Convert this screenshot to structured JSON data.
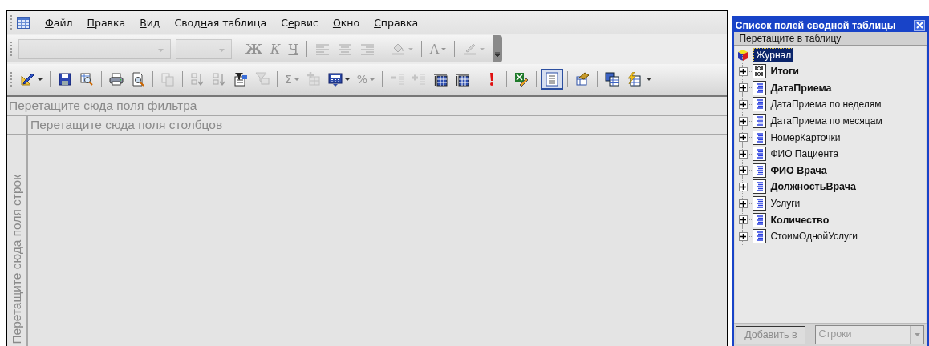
{
  "menu": [
    {
      "key": "Ф",
      "post": "айл"
    },
    {
      "key": "П",
      "post": "равка"
    },
    {
      "key": "В",
      "post": "ид"
    },
    {
      "pre": "Свод",
      "key": "н",
      "post": "ая таблица"
    },
    {
      "pre": "С",
      "key": "е",
      "post": "рвис"
    },
    {
      "key": "О",
      "post": "кно"
    },
    {
      "key": "С",
      "post": "правка"
    }
  ],
  "format_toolbar": [
    {
      "kind": "font-combo",
      "disabled": true
    },
    {
      "kind": "size-combo",
      "disabled": true
    },
    {
      "kind": "sep"
    },
    {
      "kind": "bold",
      "label": "Ж",
      "disabled": true
    },
    {
      "kind": "italic",
      "label": "К",
      "disabled": true
    },
    {
      "kind": "underline",
      "label": "Ч",
      "disabled": true
    },
    {
      "kind": "sep"
    },
    {
      "kind": "align-left",
      "disabled": true
    },
    {
      "kind": "align-center",
      "disabled": true
    },
    {
      "kind": "align-right",
      "disabled": true
    },
    {
      "kind": "sep"
    },
    {
      "kind": "fill",
      "dropdown": true,
      "disabled": true
    },
    {
      "kind": "sep"
    },
    {
      "kind": "font-color",
      "label": "A",
      "dropdown": true,
      "disabled": true
    },
    {
      "kind": "sep"
    },
    {
      "kind": "line-color",
      "dropdown": true,
      "disabled": true
    },
    {
      "kind": "overflow"
    }
  ],
  "pivot_toolbar": [
    {
      "kind": "format",
      "dropdown": true,
      "disabled": false,
      "selected": false
    },
    {
      "kind": "sep"
    },
    {
      "kind": "save",
      "disabled": false,
      "selected": false
    },
    {
      "kind": "zoom-table",
      "disabled": false,
      "selected": false
    },
    {
      "kind": "sep"
    },
    {
      "kind": "print",
      "disabled": false,
      "selected": false
    },
    {
      "kind": "preview",
      "disabled": false,
      "selected": false
    },
    {
      "kind": "sep"
    },
    {
      "kind": "copy",
      "disabled": true,
      "selected": false
    },
    {
      "kind": "sep"
    },
    {
      "kind": "sort-asc",
      "disabled": true,
      "selected": false
    },
    {
      "kind": "sort-desc",
      "disabled": true,
      "selected": false
    },
    {
      "kind": "filter",
      "disabled": false,
      "selected": false
    },
    {
      "kind": "top",
      "disabled": true,
      "selected": false
    },
    {
      "kind": "sep"
    },
    {
      "kind": "text",
      "label": "Σ",
      "dropdown": true,
      "disabled": true,
      "selected": false
    },
    {
      "kind": "subtotal",
      "disabled": true,
      "selected": false
    },
    {
      "kind": "calc",
      "dropdown": true,
      "disabled": false,
      "selected": false
    },
    {
      "kind": "text",
      "label": "%",
      "dropdown": true,
      "disabled": true,
      "selected": false
    },
    {
      "kind": "sep"
    },
    {
      "kind": "collapse",
      "disabled": true,
      "selected": false
    },
    {
      "kind": "expand",
      "disabled": true,
      "selected": false
    },
    {
      "kind": "show-top",
      "disabled": false,
      "selected": false
    },
    {
      "kind": "show-detail",
      "disabled": false,
      "selected": false
    },
    {
      "kind": "sep"
    },
    {
      "kind": "refresh",
      "disabled": false,
      "selected": false
    },
    {
      "kind": "sep"
    },
    {
      "kind": "export",
      "disabled": false,
      "selected": false
    },
    {
      "kind": "sep"
    },
    {
      "kind": "field-list",
      "disabled": false,
      "selected": true
    },
    {
      "kind": "sep"
    },
    {
      "kind": "properties",
      "disabled": false,
      "selected": false
    },
    {
      "kind": "sep"
    },
    {
      "kind": "drop-areas",
      "disabled": false,
      "selected": false
    },
    {
      "kind": "autocalc",
      "disabled": false,
      "selected": false
    },
    {
      "kind": "more"
    }
  ],
  "pivot": {
    "filter_zone": "Перетащите сюда поля фильтра",
    "column_zone": "Перетащите сюда поля столбцов",
    "row_zone": "Перетащите сюда поля строк"
  },
  "field_list": {
    "title": "Список полей сводной таблицы",
    "hint": "Перетащите в таблицу",
    "root": {
      "label": "Журнал",
      "selected": true,
      "children": [
        {
          "label": "Итоги",
          "kind": "totals",
          "bold": true,
          "expanded": false
        },
        {
          "label": "ДатаПриема",
          "kind": "field",
          "bold": true,
          "expanded": false
        },
        {
          "label": "ДатаПриема по неделям",
          "kind": "field",
          "bold": false,
          "expanded": false
        },
        {
          "label": "ДатаПриема по месяцам",
          "kind": "field",
          "bold": false,
          "expanded": false
        },
        {
          "label": "НомерКарточки",
          "kind": "field",
          "bold": false,
          "expanded": false
        },
        {
          "label": "ФИО Пациента",
          "kind": "field",
          "bold": false,
          "expanded": false
        },
        {
          "label": "ФИО Врача",
          "kind": "field",
          "bold": true,
          "expanded": false
        },
        {
          "label": "ДолжностьВрача",
          "kind": "field",
          "bold": true,
          "expanded": false
        },
        {
          "label": "Услуги",
          "kind": "field",
          "bold": false,
          "expanded": false
        },
        {
          "label": "Количество",
          "kind": "field",
          "bold": true,
          "expanded": false
        },
        {
          "label": "СтоимОднойУслуги",
          "kind": "field",
          "bold": false,
          "expanded": false
        }
      ]
    },
    "add_button": {
      "label": "Добавить в",
      "disabled": true
    },
    "area_combo": {
      "value": "Строки",
      "disabled": true
    }
  }
}
